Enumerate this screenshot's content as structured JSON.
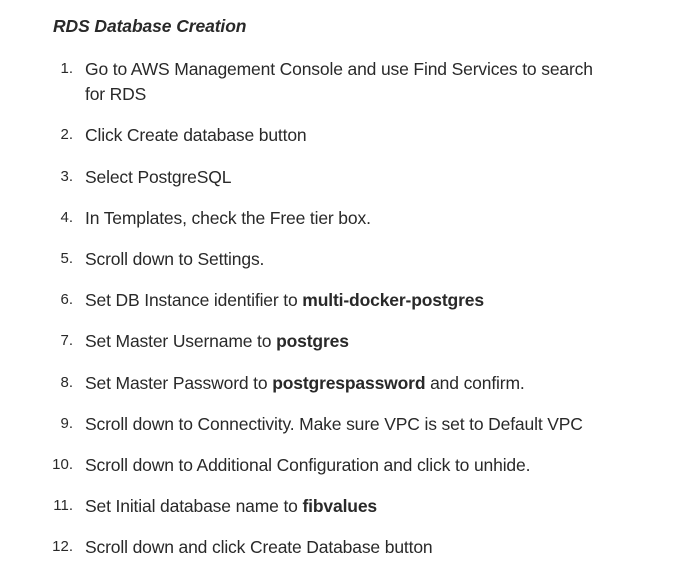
{
  "title": "RDS Database Creation",
  "steps": [
    {
      "num": "1.",
      "pre": "Go to AWS Management Console and use Find Services to search for RDS",
      "bold": "",
      "post": ""
    },
    {
      "num": "2.",
      "pre": "Click Create database button",
      "bold": "",
      "post": ""
    },
    {
      "num": "3.",
      "pre": "Select PostgreSQL",
      "bold": "",
      "post": ""
    },
    {
      "num": "4.",
      "pre": "In Templates, check the Free tier box.",
      "bold": "",
      "post": ""
    },
    {
      "num": "5.",
      "pre": "Scroll down to Settings.",
      "bold": "",
      "post": ""
    },
    {
      "num": "6.",
      "pre": "Set DB Instance identifier to ",
      "bold": "multi-docker-postgres",
      "post": ""
    },
    {
      "num": "7.",
      "pre": "Set Master Username to ",
      "bold": "postgres",
      "post": ""
    },
    {
      "num": "8.",
      "pre": "Set Master Password to ",
      "bold": "postgrespassword",
      "post": " and confirm."
    },
    {
      "num": "9.",
      "pre": "Scroll down to Connectivity. Make sure VPC is set to Default VPC",
      "bold": "",
      "post": ""
    },
    {
      "num": "10.",
      "pre": "Scroll down to Additional Configuration and click to unhide.",
      "bold": "",
      "post": ""
    },
    {
      "num": "11.",
      "pre": "Set Initial database name to ",
      "bold": "fibvalues",
      "post": ""
    },
    {
      "num": "12.",
      "pre": "Scroll down and click Create Database button",
      "bold": "",
      "post": ""
    }
  ]
}
